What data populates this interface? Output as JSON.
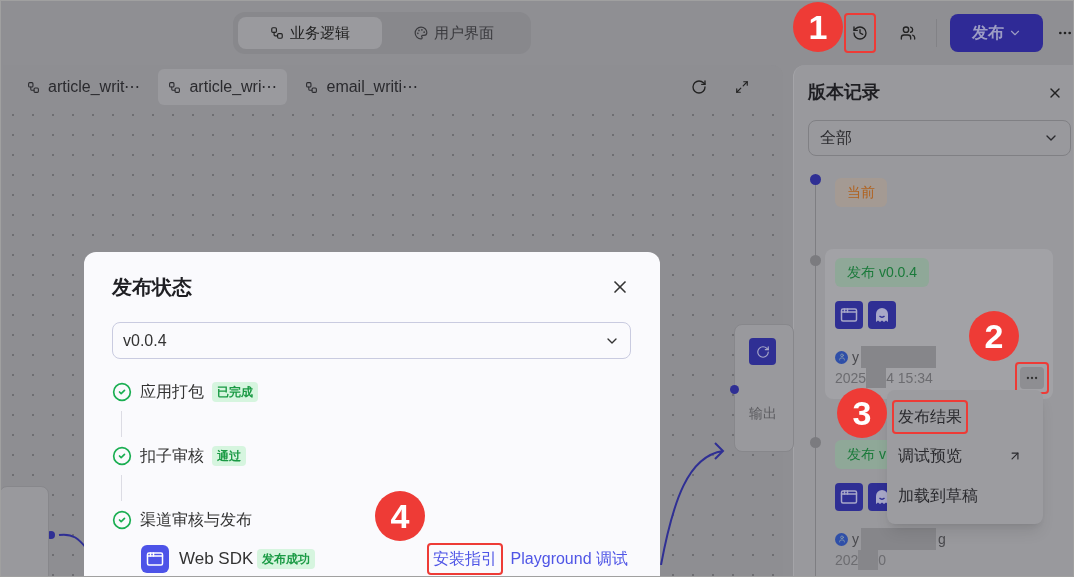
{
  "mode_tabs": [
    {
      "label": "业务逻辑",
      "selected": true
    },
    {
      "label": "用户界面",
      "selected": false
    }
  ],
  "publish_button": {
    "label": "发布"
  },
  "workflow_tabs": [
    {
      "label": "article_writ⋯",
      "selected": false
    },
    {
      "label": "article_wri⋯",
      "selected": true
    },
    {
      "label": "email_writi⋯",
      "selected": false
    }
  ],
  "canvas": {
    "node_label": "输出"
  },
  "version_panel": {
    "title": "版本记录",
    "filter": "全部",
    "entries": [
      {
        "kind": "current",
        "badge": "当前"
      },
      {
        "kind": "release",
        "badge": "发布 v0.0.4",
        "user_start": "y",
        "time_start": "2025",
        "time_end": "4 15:34",
        "highlighted": true
      },
      {
        "kind": "release",
        "badge": "发布 v",
        "user_start": "y",
        "user_end": "g",
        "time_start": "202",
        "time_end": "0",
        "highlighted": false
      }
    ]
  },
  "menu": {
    "items": [
      {
        "label": "发布结果",
        "external": false
      },
      {
        "label": "调试预览",
        "external": true
      },
      {
        "label": "加载到草稿",
        "external": false
      }
    ]
  },
  "dialog": {
    "title": "发布状态",
    "version": "v0.0.4",
    "steps": [
      {
        "label": "应用打包",
        "status": "已完成",
        "done": true
      },
      {
        "label": "扣子审核",
        "status": "通过",
        "done": true
      },
      {
        "label": "渠道审核与发布",
        "done": true
      }
    ],
    "channels": [
      {
        "name": "Web SDK",
        "status": "发布成功",
        "links": [
          "安装指引",
          "Playground 调试"
        ]
      }
    ]
  },
  "annotations": [
    "1",
    "2",
    "3",
    "4"
  ]
}
